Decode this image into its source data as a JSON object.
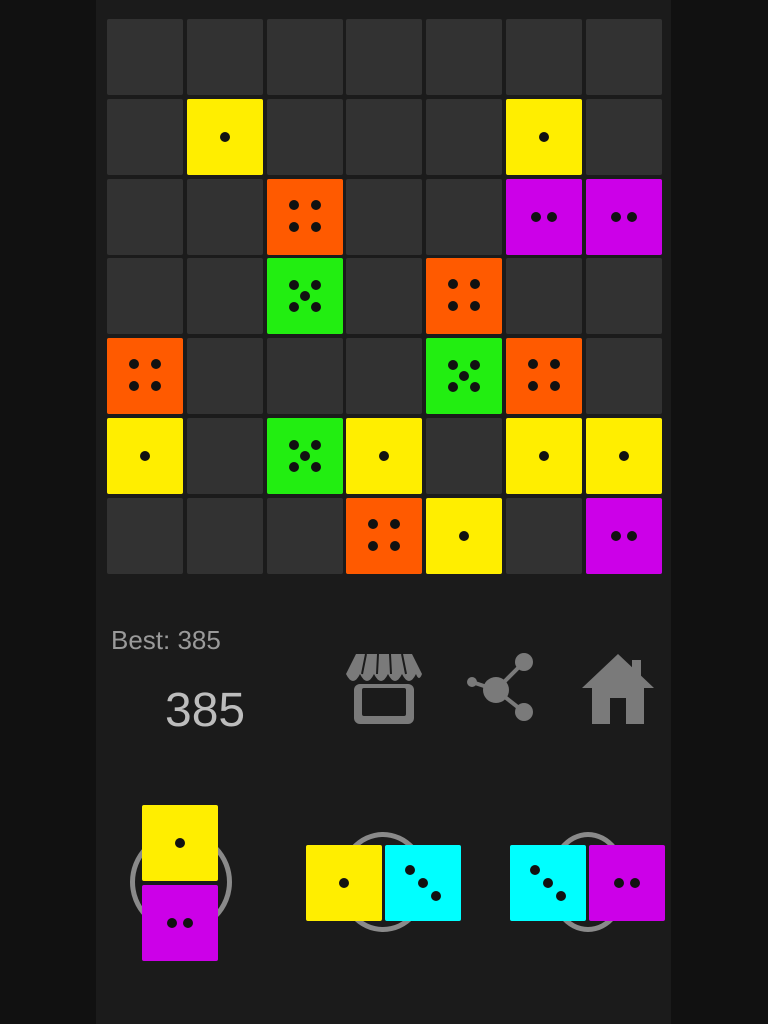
{
  "colors": {
    "yellow": "#ffee00",
    "orange": "#ff5a00",
    "purple": "#cc00e8",
    "green": "#22ee11",
    "cyan": "#00ffff",
    "empty": "#323232",
    "background": "#111111"
  },
  "board": {
    "rows": 7,
    "cols": 7,
    "tiles": [
      {
        "row": 1,
        "col": 1,
        "color": "yellow",
        "value": 1
      },
      {
        "row": 1,
        "col": 5,
        "color": "yellow",
        "value": 1
      },
      {
        "row": 2,
        "col": 2,
        "color": "orange",
        "value": 4
      },
      {
        "row": 2,
        "col": 5,
        "color": "purple",
        "value": 2
      },
      {
        "row": 2,
        "col": 6,
        "color": "purple",
        "value": 2
      },
      {
        "row": 3,
        "col": 2,
        "color": "green",
        "value": 5
      },
      {
        "row": 3,
        "col": 4,
        "color": "orange",
        "value": 4
      },
      {
        "row": 4,
        "col": 0,
        "color": "orange",
        "value": 4
      },
      {
        "row": 4,
        "col": 4,
        "color": "green",
        "value": 5
      },
      {
        "row": 4,
        "col": 5,
        "color": "orange",
        "value": 4
      },
      {
        "row": 5,
        "col": 0,
        "color": "yellow",
        "value": 1
      },
      {
        "row": 5,
        "col": 2,
        "color": "green",
        "value": 5
      },
      {
        "row": 5,
        "col": 3,
        "color": "yellow",
        "value": 1
      },
      {
        "row": 5,
        "col": 5,
        "color": "yellow",
        "value": 1
      },
      {
        "row": 5,
        "col": 6,
        "color": "yellow",
        "value": 1
      },
      {
        "row": 6,
        "col": 3,
        "color": "orange",
        "value": 4
      },
      {
        "row": 6,
        "col": 4,
        "color": "yellow",
        "value": 1
      },
      {
        "row": 6,
        "col": 6,
        "color": "purple",
        "value": 2
      }
    ]
  },
  "stats": {
    "best_label": "Best: 385",
    "score": "385"
  },
  "toolbar": {
    "icons": [
      "shop-icon",
      "share-icon",
      "home-icon"
    ]
  },
  "pieces": [
    {
      "orientation": "vertical",
      "dice": [
        {
          "color": "yellow",
          "value": 1
        },
        {
          "color": "purple",
          "value": 2
        }
      ]
    },
    {
      "orientation": "horizontal",
      "dice": [
        {
          "color": "yellow",
          "value": 1
        },
        {
          "color": "cyan",
          "value": 3
        }
      ]
    },
    {
      "orientation": "horizontal",
      "dice": [
        {
          "color": "cyan",
          "value": 3
        },
        {
          "color": "purple",
          "value": 2
        }
      ]
    }
  ]
}
